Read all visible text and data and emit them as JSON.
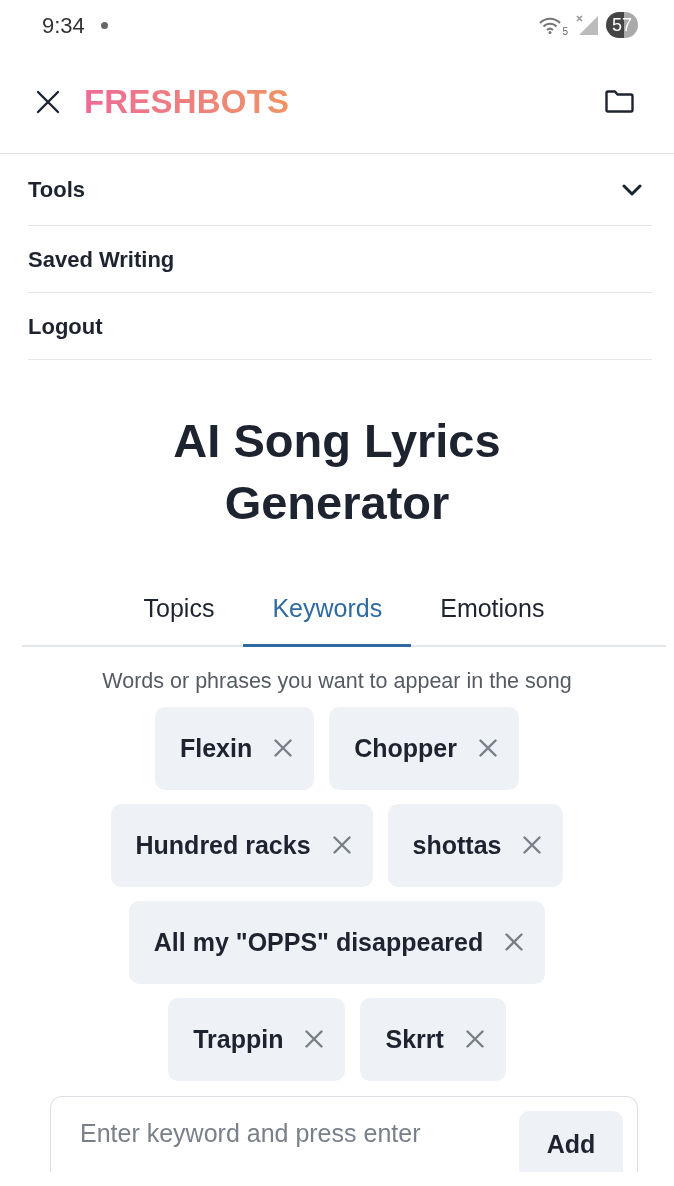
{
  "status_bar": {
    "time": "9:34",
    "network_type": "5",
    "battery": "57"
  },
  "header": {
    "brand": "FRESHBOTS"
  },
  "menu": [
    {
      "label": "Tools",
      "kind": "dropdown",
      "expanded": false
    },
    {
      "label": "Saved Writing",
      "kind": "link"
    },
    {
      "label": "Logout",
      "kind": "link"
    }
  ],
  "title": "AI Song Lyrics Generator",
  "tabs": [
    {
      "label": "Topics",
      "selected": false
    },
    {
      "label": "Keywords",
      "selected": true
    },
    {
      "label": "Emotions",
      "selected": false
    }
  ],
  "hint": "Words or phrases you want to appear in the song",
  "keywords": [
    "Flexin",
    "Chopper",
    "Hundred racks",
    "shottas",
    "All my \"OPPS\" disappeared",
    "Trappin",
    "Skrrt"
  ],
  "input": {
    "placeholder": "Enter keyword and press enter"
  },
  "add_button": "Add"
}
